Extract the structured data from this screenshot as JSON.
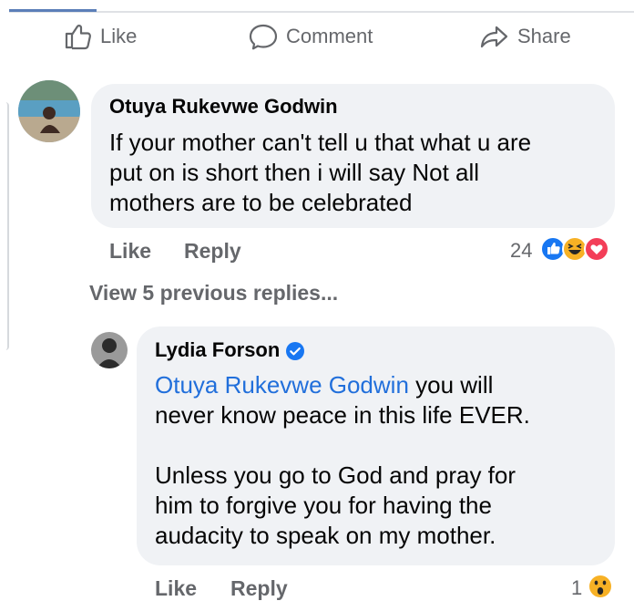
{
  "post_actions": {
    "like_label": "Like",
    "comment_label": "Comment",
    "share_label": "Share"
  },
  "comment1": {
    "author": "Otuya Rukevwe Godwin",
    "text": "If your mother can't tell u that what u are\nput on is short then i will say Not all\nmothers are to be celebrated",
    "like_label": "Like",
    "reply_label": "Reply",
    "reaction_count": "24",
    "reactions": [
      "like-reaction-icon",
      "haha-reaction-icon",
      "love-reaction-icon"
    ]
  },
  "view_previous": "View 5 previous replies...",
  "reply1": {
    "author": "Lydia Forson",
    "verified": true,
    "mention": "Otuya Rukevwe Godwin",
    "text_after_mention": " you will\nnever know peace in this life EVER.\n\nUnless you go to God and pray for\nhim to forgive you for having the\naudacity to speak on my mother.",
    "like_label": "Like",
    "reply_label": "Reply",
    "reaction_count": "1",
    "reactions": [
      "wow-reaction-icon"
    ]
  },
  "colors": {
    "bubble": "#f0f2f5",
    "mention": "#216fdb",
    "muted": "#65676b",
    "like_blue": "#1877f2",
    "love_red": "#f33e58",
    "haha_yellow": "#f7b125"
  }
}
